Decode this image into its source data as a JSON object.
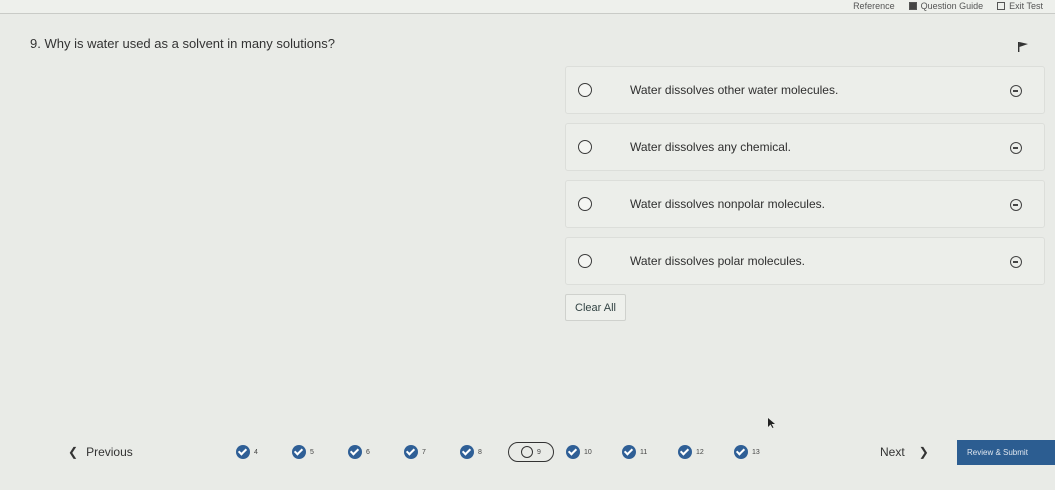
{
  "topbar": {
    "reference_label": "Reference",
    "question_guide_label": "Question Guide",
    "exit_label": "Exit Test"
  },
  "question": {
    "text": "9. Why is water used as a solvent in many solutions?"
  },
  "choices": [
    {
      "label": "Water dissolves other water molecules."
    },
    {
      "label": "Water dissolves any chemical."
    },
    {
      "label": "Water dissolves nonpolar molecules."
    },
    {
      "label": "Water dissolves polar molecules."
    }
  ],
  "clear_label": "Clear All",
  "nav": {
    "previous_label": "Previous",
    "next_label": "Next",
    "submit_label": "Review & Submit",
    "items": [
      {
        "num": "4",
        "state": "answered"
      },
      {
        "num": "5",
        "state": "answered"
      },
      {
        "num": "6",
        "state": "answered"
      },
      {
        "num": "7",
        "state": "answered"
      },
      {
        "num": "8",
        "state": "answered"
      },
      {
        "num": "9",
        "state": "current"
      },
      {
        "num": "10",
        "state": "answered"
      },
      {
        "num": "11",
        "state": "answered"
      },
      {
        "num": "12",
        "state": "answered"
      },
      {
        "num": "13",
        "state": "answered"
      }
    ]
  },
  "colors": {
    "accent": "#2c5d91",
    "background": "#e9ebe7"
  }
}
